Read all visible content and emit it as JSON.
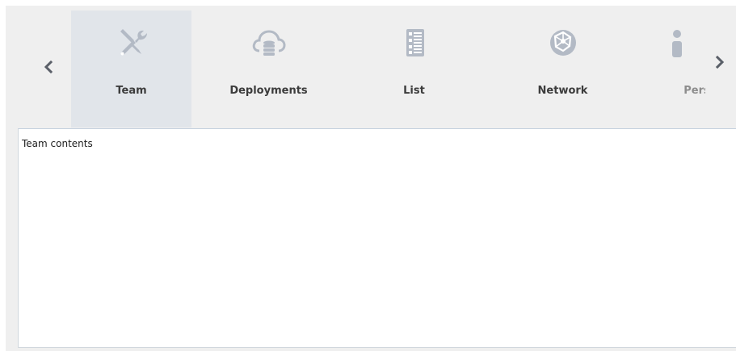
{
  "tabs": [
    {
      "label": "Team",
      "icon": "tools-icon",
      "selected": true
    },
    {
      "label": "Deployments",
      "icon": "cloud-database-icon",
      "selected": false
    },
    {
      "label": "List",
      "icon": "list-icon",
      "selected": false
    },
    {
      "label": "Network",
      "icon": "globe-network-icon",
      "selected": false
    },
    {
      "label": "Pers",
      "icon": "person-icon",
      "selected": false
    }
  ],
  "scroll": {
    "left_icon": "chevron-left-icon",
    "right_icon": "chevron-right-icon"
  },
  "content": {
    "text": "Team contents"
  },
  "colors": {
    "icon": "#b3bac5",
    "selected_tab": "#e1e5ea",
    "background": "#efefef",
    "chevron": "#5a5f68"
  }
}
